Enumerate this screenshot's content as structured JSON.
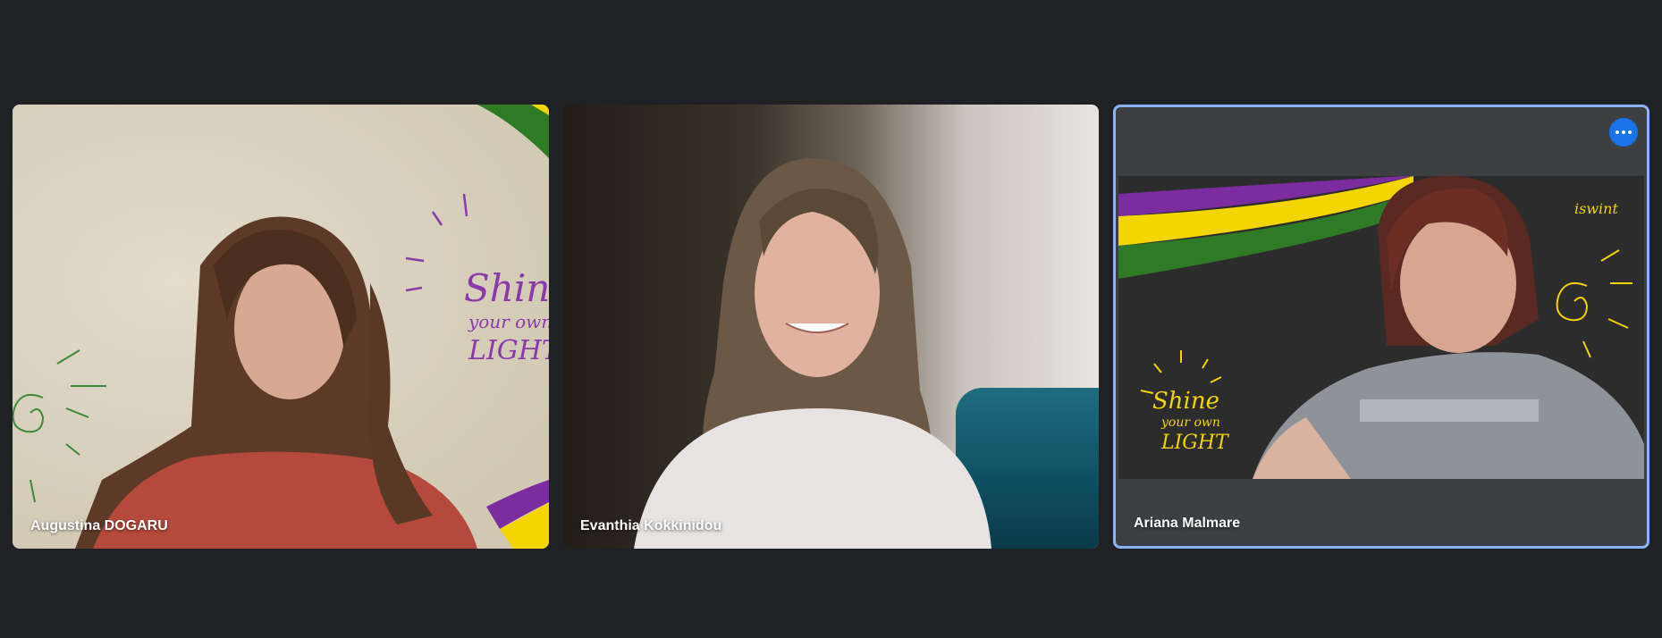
{
  "participants": [
    {
      "name": "Augustina DOGARU"
    },
    {
      "name": "Evanthia Kokkinidou"
    },
    {
      "name": "Ariana Malmare"
    }
  ],
  "background_text": {
    "shine": "Shine",
    "your_own": "your own",
    "light": "LIGHT",
    "brand": "iswint"
  },
  "icons": {
    "more_options": "more-options-icon"
  },
  "colors": {
    "page_bg": "#202124",
    "tile_bg": "#3c4043",
    "active_border": "#8ab4f8",
    "button_blue": "#1a73e8",
    "brand_purple": "#7b2c9e",
    "brand_yellow": "#f3d500",
    "brand_green": "#2f7a24"
  }
}
